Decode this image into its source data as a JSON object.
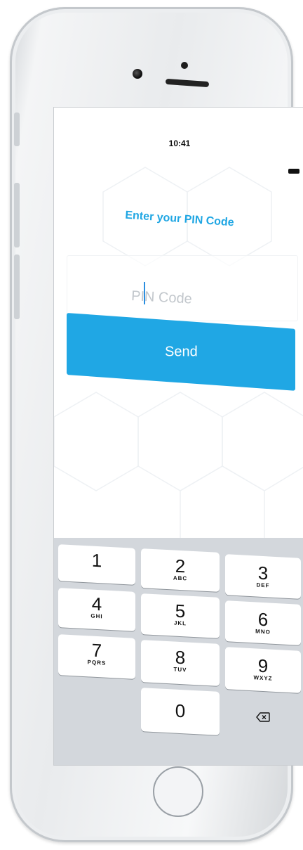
{
  "status_bar": {
    "time": "10:41"
  },
  "pin_screen": {
    "title": "Enter your PIN Code",
    "input_placeholder": "PIN Code",
    "send_label": "Send"
  },
  "keypad": {
    "keys": [
      {
        "num": "1",
        "letters": ""
      },
      {
        "num": "2",
        "letters": "ABC"
      },
      {
        "num": "3",
        "letters": "DEF"
      },
      {
        "num": "4",
        "letters": "GHI"
      },
      {
        "num": "5",
        "letters": "JKL"
      },
      {
        "num": "6",
        "letters": "MNO"
      },
      {
        "num": "7",
        "letters": "PQRS"
      },
      {
        "num": "8",
        "letters": "TUV"
      },
      {
        "num": "9",
        "letters": "WXYZ"
      },
      {
        "num": "0",
        "letters": ""
      }
    ],
    "delete_icon": "backspace-icon"
  },
  "colors": {
    "accent": "#20a7e4",
    "keypad_bg": "#d3d7dc"
  }
}
